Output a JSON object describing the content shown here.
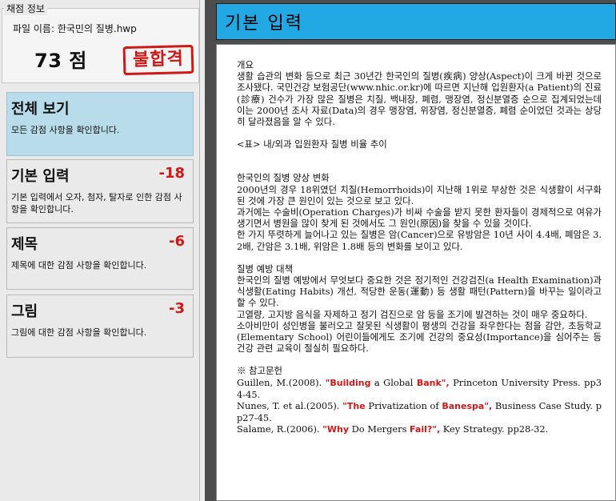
{
  "left_panel": {
    "legend": "채점 정보",
    "file_label": "파일 이름: 한국민의 질병.hwp",
    "score": "73 점",
    "stamp": "불합격",
    "cards": [
      {
        "title": "전체 보기",
        "delta": "",
        "desc": "모든 감점 사항을 확인합니다."
      },
      {
        "title": "기본 입력",
        "delta": "-18",
        "desc": "기본 입력에서 오자, 첨자, 탈자로 인한 감점 사항을 확인합니다."
      },
      {
        "title": "제목",
        "delta": "-6",
        "desc": "제목에 대한 감점 사항을 확인합니다."
      },
      {
        "title": "그림",
        "delta": "-3",
        "desc": "그림에 대한 감점 사항을 확인합니다."
      }
    ]
  },
  "right_panel": {
    "header": "기본 입력",
    "doc": {
      "p1": "개요",
      "p2": "생활 습관의 변화 등으로 최근 30년간 한국인의 질병(疾病) 양상(Aspect)이 크게 바뀐 것으로 조사됐다. 국민건강 보험공단(www.nhic.or.kr)에 따르면 지난해 입원환자(a Patient)의 진료(診療) 건수가 가장 많은 질병은 치질, 백내장, 폐렴, 맹장염, 정신분열증 순으로 집계되었는데 이는 2000년 조사 자료(Data)의 경우 맹장염, 위장염, 정신분열증, 폐렴 순이었던 것과는 상당히 달라졌음을 알 수 있다.",
      "p3": "<표> 내/외과 입원환자 질병 비율 추이",
      "p4": "한국인의 질병 양상 변화",
      "p5": "2000년의 경우 18위였던 치질(Hemorrhoids)이 지난해 1위로 부상한 것은 식생활이 서구화된 것에 가장 큰 원인이 있는 것으로 보고 있다.",
      "p6": "과거에는 수술비(Operation Charges)가 비싸 수술을 받지 못한 환자들이 경제적으로 여유가 생기면서 병원을 많이 찾게 된 것에서도 그 원인(原因)을 찾을 수 있을 것이다.",
      "p7": "한 가지 뚜렷하게 늘어나고 있는 질병은 암(Cancer)으로 유방암은 10년 사이 4.4배, 폐암은 3.2배, 간암은 3.1배, 위암은 1.8배 등의 변화를 보이고 있다.",
      "p8": "질병 예방 대책",
      "p9": "한국인의 질병 예방에서 무엇보다 중요한 것은 정기적인 건강검진(a Health Examination)과 식생활(Eating Habits) 개선, 적당한 운동(運動) 등 생활 패턴(Pattern)을 바꾸는 일이라고 할 수 있다.",
      "p10": "고열량, 고지방 음식을 자제하고 정기 검진으로 암 등을 조기에 발견하는 것이 매우 중요하다.",
      "p11": "소아비만이 성인병을 불러오고 잘못된 식생활이 평생의 건강을 좌우한다는 점을 감안, 초등학교(Elementary School) 어린이들에게도 조기에 건강의 중요성(Importance)을 심어주는 등 건강 관련 교육이 절실히 필요하다.",
      "ref_title": "※ 참고문헌",
      "ref1_a": "Guillen, M.(2008). ",
      "ref1_hl1": "\"Building",
      "ref1_b": " a Global ",
      "ref1_hl2": "Bank\",",
      "ref1_c": " Princeton University Press. pp34-45.",
      "ref2_a": "Nunes, T. et al.(2005). ",
      "ref2_hl1": "\"The",
      "ref2_b": " Privatization of ",
      "ref2_hl2": "Banespa\",",
      "ref2_c": " Business Case Study. pp27-45.",
      "ref3_a": "Salame, R.(2006). ",
      "ref3_hl1": "\"Why",
      "ref3_b": " Do Mergers ",
      "ref3_hl2": "Fail?\",",
      "ref3_c": " Key Strategy. pp28-32."
    }
  },
  "colors": {
    "accent_blue": "#22a9e3",
    "active_card": "#b9dcea",
    "error_red": "#d01818",
    "dark_bg": "#4d4d4d"
  }
}
